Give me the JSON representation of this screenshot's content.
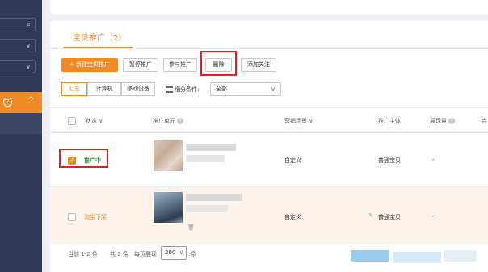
{
  "sidebar": {
    "active_chevron": "^",
    "active_icon": "?"
  },
  "tab": {
    "title": "宝贝推广（2）"
  },
  "toolbar": {
    "new_promo": "+ 新建宝贝推广",
    "pause": "暂停推广",
    "join": "参与推广",
    "delete": "删除",
    "follow": "添加关注"
  },
  "filters": {
    "segments": [
      "汇总",
      "计算机",
      "移动设备"
    ],
    "detail_label": "细分条件:",
    "select_value": "全部"
  },
  "table": {
    "headers": {
      "status": "状态 ∨",
      "unit": "推广单元",
      "scene": "营销场景 ∨",
      "subject": "推广主体",
      "impressions": "展现量",
      "click": "点"
    },
    "rows": [
      {
        "status": "推广中",
        "scene": "自定义",
        "subject": "普通宝贝",
        "impressions": "-",
        "checked": true
      },
      {
        "status": "淘宝下架",
        "scene": "自定义",
        "subject": "普通宝贝",
        "impressions": "-",
        "checked": false
      }
    ]
  },
  "footer": {
    "range": "当前 1-2 条",
    "total": "共 2 条",
    "per_page_label": "每页展现",
    "per_page_value": "200",
    "unit": "条"
  },
  "colors": {
    "accent": "#f08a24",
    "sidebar": "#2e3a57",
    "highlight": "#e02020"
  }
}
